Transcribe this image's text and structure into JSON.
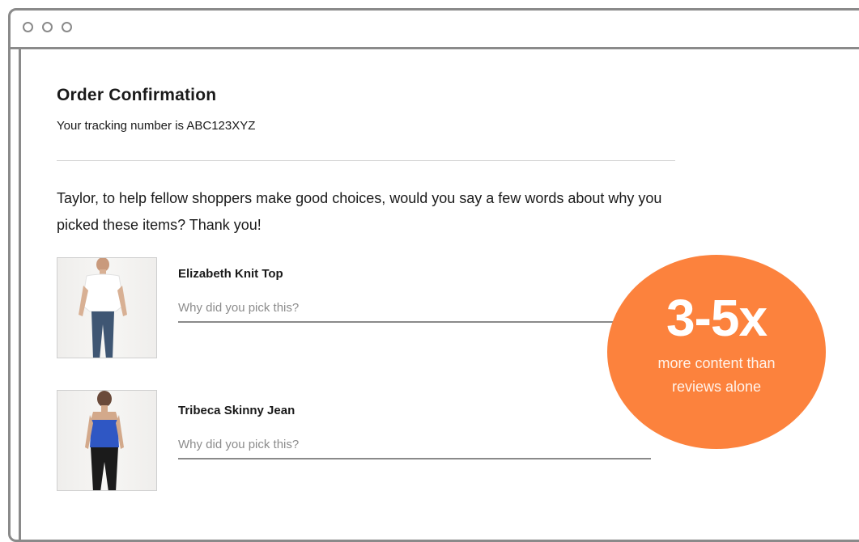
{
  "page": {
    "title": "Order Confirmation",
    "tracking_text": "Your tracking number is ABC123XYZ",
    "message": "Taylor, to help fellow shoppers make good choices, would you say a few words about why you picked these items? Thank you!"
  },
  "items": [
    {
      "name": "Elizabeth Knit Top",
      "placeholder": "Why did you pick this?"
    },
    {
      "name": "Tribeca Skinny Jean",
      "placeholder": "Why did you pick this?"
    }
  ],
  "badge": {
    "headline": "3-5x",
    "subtext_line1": "more content than",
    "subtext_line2": "reviews alone",
    "color": "#fc823d"
  }
}
